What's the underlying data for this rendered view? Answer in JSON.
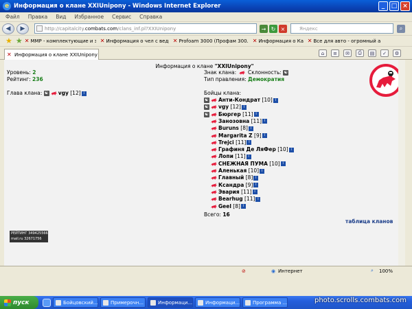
{
  "window": {
    "title": "Информация о клане XXIUnipony - Windows Internet Explorer",
    "menu": [
      "Файл",
      "Правка",
      "Вид",
      "Избранное",
      "Сервис",
      "Справка"
    ]
  },
  "address": {
    "url_prefix": "http://capitalcity.",
    "url_domain": "combats.com",
    "url_suffix": "/clans_inf.pl?XXIUnipony",
    "search_placeholder": "Яндекс"
  },
  "favorites": [
    "ММР - комплектующие и з...",
    "Информация о чел с ведром",
    "Profoam 3000 (Профам 300...",
    "Информация о Казль",
    "Все для авто - огромный а..."
  ],
  "tab": {
    "label": "Информация о клане XXIUnipony"
  },
  "clan": {
    "header_prefix": "Информация о клане ",
    "name": "\"XXIUnipony\"",
    "level_label": "Уровень:",
    "level": "2",
    "rating_label": "Рейтинг:",
    "rating": "236",
    "sign_label": "Знак клана:",
    "alignment_label": "Склонность:",
    "government_label": "Тип правления:",
    "government": "Демократия",
    "leader_label": "Глава клана:",
    "leader_name": "vgy",
    "leader_level": "[12]",
    "fighters_label": "Бойцы клана:",
    "total_label": "Всего:",
    "total": "16",
    "clans_table_link": "таблица кланов"
  },
  "members": [
    {
      "name": "Анти-Кондрат",
      "level": "[10]",
      "extra": true
    },
    {
      "name": "vgy",
      "level": "[12]",
      "extra": true
    },
    {
      "name": "Бюргер",
      "level": "[11]",
      "extra": true
    },
    {
      "name": "Занозовна",
      "level": "[11]",
      "extra": false
    },
    {
      "name": "Buruns",
      "level": "[8]",
      "extra": false
    },
    {
      "name": "Margarita Z",
      "level": "[9]",
      "extra": false
    },
    {
      "name": "Trejci",
      "level": "[11]",
      "extra": false
    },
    {
      "name": "Графиня Де ЛяФер",
      "level": "[10]",
      "extra": false
    },
    {
      "name": "Лопи",
      "level": "[11]",
      "extra": false
    },
    {
      "name": "СНЕЖНАЯ ПУМА",
      "level": "[10]",
      "extra": false
    },
    {
      "name": "Аленькая",
      "level": "[10]",
      "extra": false
    },
    {
      "name": "Главный",
      "level": "[8]",
      "extra": false
    },
    {
      "name": "Ксандра",
      "level": "[9]",
      "extra": false
    },
    {
      "name": "Эвария",
      "level": "[11]",
      "extra": false
    },
    {
      "name": "Bearhug",
      "level": "[11]",
      "extra": false
    },
    {
      "name": "Geel",
      "level": "[8]",
      "extra": false
    }
  ],
  "counter_badge": {
    "line1": "РЕЙТИНГ 349425566",
    "line2": "mail.ru 32671756"
  },
  "status": {
    "zone": "Интернет",
    "zoom": "100%"
  },
  "taskbar": {
    "start": "пуск",
    "items": [
      "Бойцовский...",
      "Примерочн...",
      "Информаци...",
      "Информаци...",
      "Программа ..."
    ],
    "watermark": "photo.scrolls.combats.com"
  },
  "colors": {
    "accent_green": "#1a7f1a",
    "unicorn": "#e61c3c",
    "info_button": "#1d4fa8"
  }
}
